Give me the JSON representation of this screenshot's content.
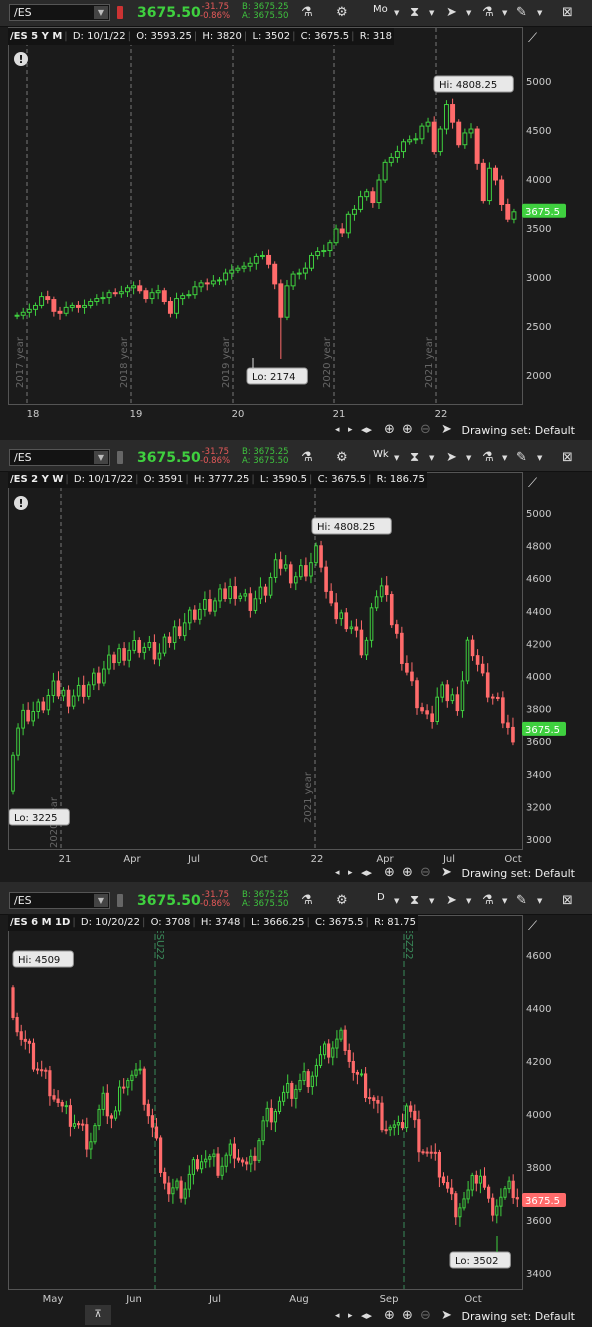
{
  "colors": {
    "up": "#3fd03f",
    "down": "#ff6b6b",
    "grid": "#4a4a4a",
    "text": "#cccccc",
    "bg": "#1b1b1b"
  },
  "toolbar": {
    "symbol": "/ES",
    "last_price": "3675.50",
    "change": "-31.75",
    "change_pct": "-0.86%",
    "bid": "B: 3675.25",
    "ask": "A: 3675.50"
  },
  "panels": [
    {
      "aggregation": "Mo",
      "info": {
        "symbol": "/ES 5 Y M",
        "date": "D: 10/1/22",
        "open": "O: 3593.25",
        "high": "H: 3820",
        "low": "L: 3502",
        "close": "C: 3675.5",
        "range": "R: 318"
      },
      "hi_label": "Hi: 4808.25",
      "lo_label": "Lo: 2174",
      "price_badge": "3675.5",
      "y_ticks": [
        "5000",
        "4500",
        "4000",
        "3500",
        "3000",
        "2500",
        "2000"
      ],
      "x_ticks": [
        "18",
        "19",
        "20",
        "21",
        "22"
      ],
      "year_markers": [
        "2017 year",
        "2018 year",
        "2019 year",
        "2020 year",
        "2021 year"
      ],
      "drawing_set": "Drawing set: Default"
    },
    {
      "aggregation": "Wk",
      "info": {
        "symbol": "/ES 2 Y W",
        "date": "D: 10/17/22",
        "open": "O: 3591",
        "high": "H: 3777.25",
        "low": "L: 3590.5",
        "close": "C: 3675.5",
        "range": "R: 186.75"
      },
      "hi_label": "Hi: 4808.25",
      "lo_label": "Lo: 3225",
      "price_badge": "3675.5",
      "y_ticks": [
        "5000",
        "4800",
        "4600",
        "4400",
        "4200",
        "4000",
        "3800",
        "3600",
        "3400",
        "3200",
        "3000"
      ],
      "x_ticks": [
        "21",
        "Apr",
        "Jul",
        "Oct",
        "22",
        "Apr",
        "Jul",
        "Oct"
      ],
      "year_markers": [
        "2020 year",
        "2021 year"
      ],
      "drawing_set": "Drawing set: Default"
    },
    {
      "aggregation": "D",
      "info": {
        "symbol": "/ES 6 M 1D",
        "date": "D: 10/20/22",
        "open": "O: 3708",
        "high": "H: 3748",
        "low": "L: 3666.25",
        "close": "C: 3675.5",
        "range": "R: 81.75"
      },
      "hi_label": "Hi: 4509",
      "lo_label": "Lo: 3502",
      "price_badge": "3675.5",
      "y_ticks": [
        "4600",
        "4400",
        "4200",
        "4000",
        "3800",
        "3600",
        "3400"
      ],
      "x_ticks": [
        "May",
        "Jun",
        "Jul",
        "Aug",
        "Sep",
        "Oct"
      ],
      "year_markers": [
        "/ESU22",
        "/ESZ22"
      ],
      "drawing_set": "Drawing set: Default"
    }
  ],
  "chart_data": [
    {
      "type": "candlestick",
      "title": "/ES 5 Y M",
      "ylim": [
        1850,
        5350
      ],
      "y_ticks": [
        5000,
        4500,
        4000,
        3500,
        3000,
        2500,
        2000
      ],
      "high": 4808.25,
      "low": 2174,
      "last": 3675.5,
      "closes": [
        2620,
        2650,
        2680,
        2720,
        2810,
        2780,
        2660,
        2640,
        2700,
        2720,
        2700,
        2720,
        2760,
        2790,
        2800,
        2850,
        2840,
        2860,
        2900,
        2920,
        2870,
        2790,
        2850,
        2870,
        2760,
        2640,
        2790,
        2820,
        2830,
        2910,
        2950,
        2940,
        2970,
        2980,
        3050,
        3080,
        3100,
        3120,
        3150,
        3220,
        3230,
        3140,
        2940,
        2600,
        2920,
        3040,
        3050,
        3100,
        3230,
        3270,
        3280,
        3360,
        3500,
        3460,
        3650,
        3700,
        3830,
        3880,
        3770,
        4000,
        4180,
        4230,
        4290,
        4390,
        4410,
        4420,
        4550,
        4590,
        4290,
        4520,
        4770,
        4590,
        4360,
        4480,
        4520,
        4170,
        3790,
        4120,
        4000,
        3750,
        3600,
        3675.5
      ]
    }
  ],
  "x_note": "5Y monthly"
}
